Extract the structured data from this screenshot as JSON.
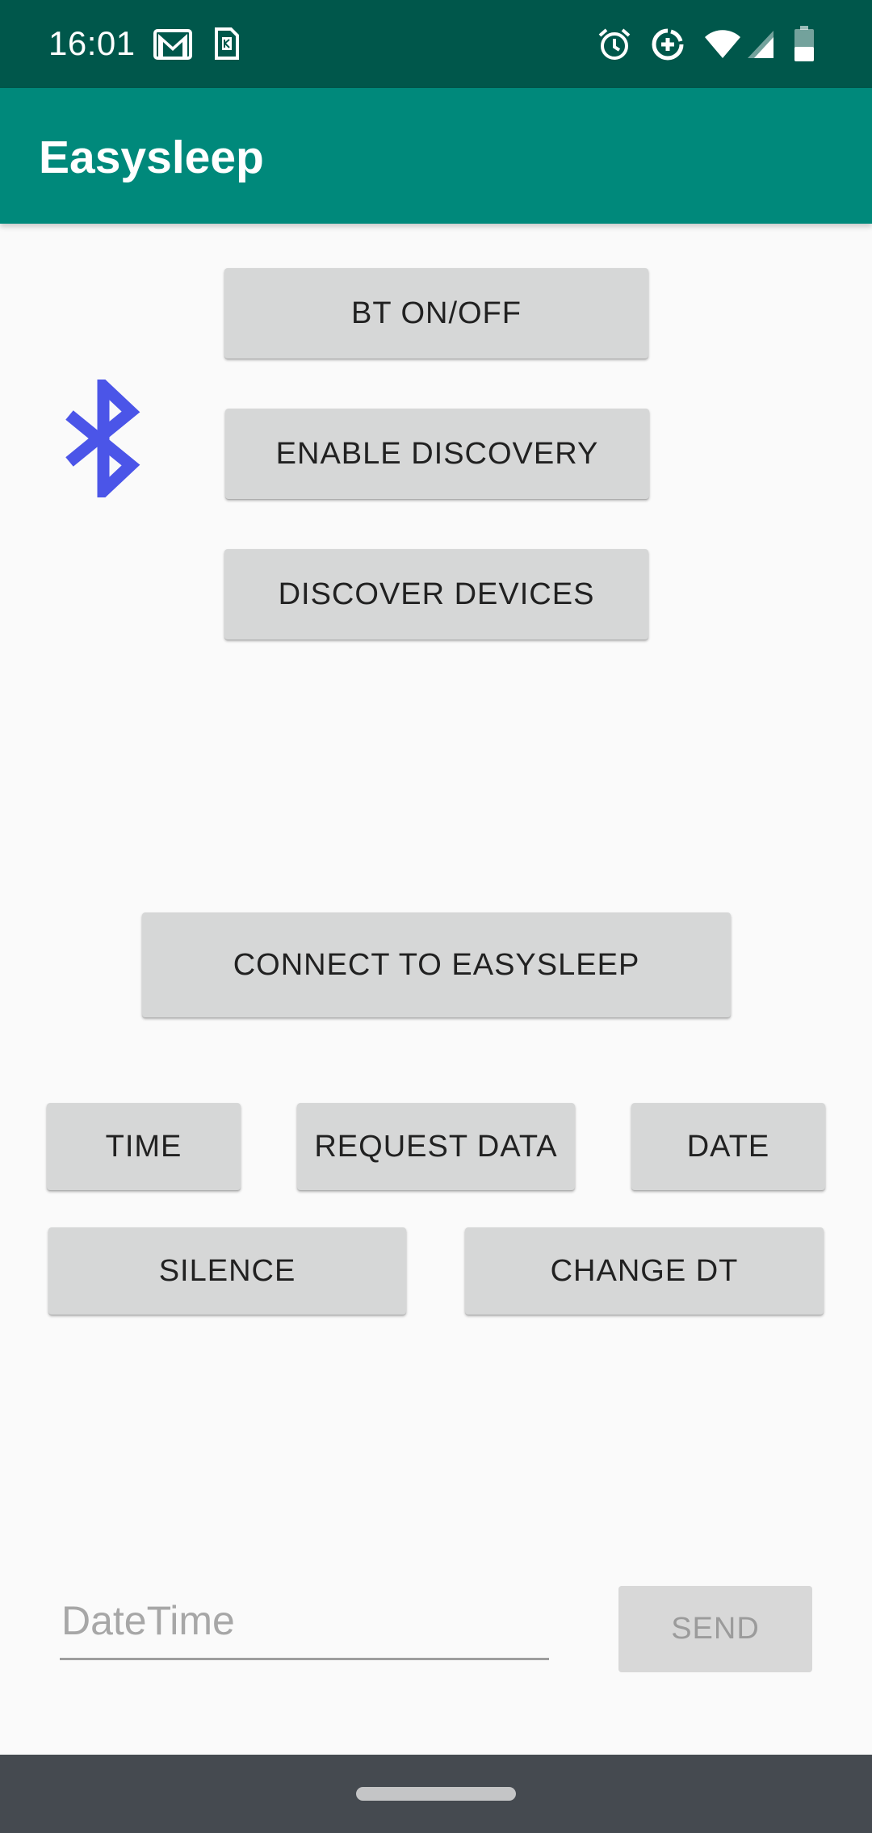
{
  "status_bar": {
    "time": "16:01",
    "left_icons": [
      "gmail-icon",
      "sim-card-icon"
    ],
    "right_icons": [
      "alarm-icon",
      "data-saver-icon",
      "wifi-icon",
      "signal-icon",
      "battery-icon"
    ]
  },
  "app_bar": {
    "title": "Easysleep",
    "color": "#00897b",
    "status_color": "#00574b"
  },
  "bluetooth": {
    "icon": "bluetooth-icon",
    "color": "#4b55e8"
  },
  "buttons": {
    "bt_toggle": "BT ON/OFF",
    "enable_discovery": "ENABLE DISCOVERY",
    "discover_devices": "DISCOVER DEVICES",
    "connect": "CONNECT TO EASYSLEEP",
    "time": "TIME",
    "request_data": "REQUEST DATA",
    "date": "DATE",
    "silence": "SILENCE",
    "change_dt": "CHANGE DT",
    "send": "SEND"
  },
  "datetime_field": {
    "placeholder": "DateTime",
    "value": ""
  },
  "navigation": {
    "handle": "home-gesture-handle"
  }
}
